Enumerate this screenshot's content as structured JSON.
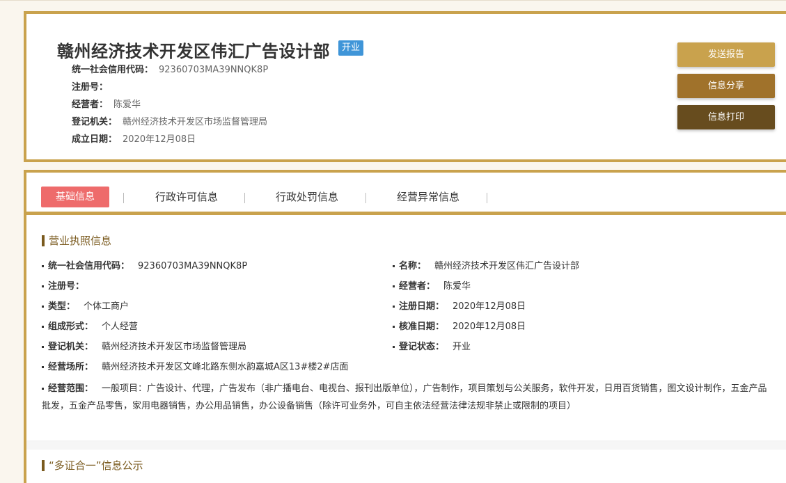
{
  "header": {
    "company_name": "赣州经济技术开发区伟汇广告设计部",
    "status_badge": "开业",
    "rows": [
      {
        "label": "统一社会信用代码：",
        "value": "92360703MA39NNQK8P"
      },
      {
        "label": "注册号：",
        "value": ""
      },
      {
        "label": "经营者：",
        "value": "陈爱华"
      },
      {
        "label": "登记机关：",
        "value": "赣州经济技术开发区市场监督管理局"
      },
      {
        "label": "成立日期：",
        "value": "2020年12月08日"
      }
    ],
    "buttons": {
      "send_report": "发送报告",
      "share_info": "信息分享",
      "print_info": "信息打印"
    }
  },
  "tabs": [
    {
      "label": "基础信息",
      "active": true
    },
    {
      "label": "行政许可信息",
      "active": false
    },
    {
      "label": "行政处罚信息",
      "active": false
    },
    {
      "label": "经营异常信息",
      "active": false
    }
  ],
  "license_section": {
    "title": "营业执照信息",
    "left_fields": [
      {
        "label": "统一社会信用代码：",
        "value": "92360703MA39NNQK8P"
      },
      {
        "label": "注册号：",
        "value": ""
      },
      {
        "label": "类型：",
        "value": "个体工商户"
      },
      {
        "label": "组成形式：",
        "value": "个人经营"
      },
      {
        "label": "登记机关：",
        "value": "赣州经济技术开发区市场监督管理局"
      },
      {
        "label": "经营场所：",
        "value": "赣州经济技术开发区文峰北路东侧水韵嘉城A区13#楼2#店面"
      }
    ],
    "right_fields": [
      {
        "label": "名称：",
        "value": "赣州经济技术开发区伟汇广告设计部"
      },
      {
        "label": "经营者：",
        "value": "陈爱华"
      },
      {
        "label": "注册日期：",
        "value": "2020年12月08日"
      },
      {
        "label": "核准日期：",
        "value": "2020年12月08日"
      },
      {
        "label": "登记状态：",
        "value": "开业"
      }
    ],
    "scope": {
      "label": "经营范围：",
      "value": "一般项目：广告设计、代理，广告发布（非广播电台、电视台、报刊出版单位），广告制作，项目策划与公关服务，软件开发，日用百货销售，图文设计制作，五金产品批发，五金产品零售，家用电器销售，办公用品销售，办公设备销售（除许可业务外，可自主依法经营法律法规非禁止或限制的项目）"
    }
  },
  "multi_cert_section": {
    "title": "“多证合一”信息公示"
  },
  "colors": {
    "gold": "#c9a24d",
    "brown": "#a0722b",
    "dark_brown": "#674c1e",
    "active_tab": "#ee6b6b",
    "badge_blue": "#3f95d8"
  }
}
